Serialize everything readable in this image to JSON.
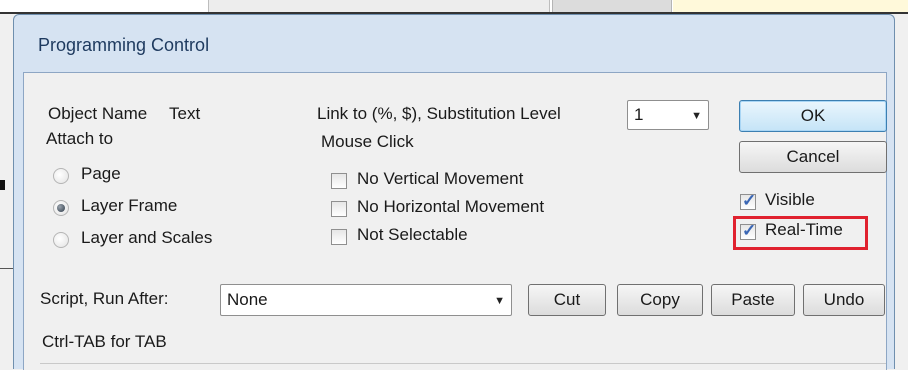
{
  "dialog": {
    "title": "Programming Control",
    "object_name_label": "Object Name",
    "object_name_value": "Text",
    "attach_to_label": "Attach to",
    "attach_options": [
      {
        "label": "Page",
        "selected": false
      },
      {
        "label": "Layer Frame",
        "selected": true
      },
      {
        "label": "Layer and Scales",
        "selected": false
      }
    ],
    "link_label": "Link to (%, $), Substitution Level",
    "substitution_level": "1",
    "mouse_click_label": "Mouse Click",
    "mouse_options": [
      {
        "label": "No Vertical Movement",
        "checked": false
      },
      {
        "label": "No Horizontal Movement",
        "checked": false
      },
      {
        "label": "Not Selectable",
        "checked": false
      }
    ],
    "ok_label": "OK",
    "cancel_label": "Cancel",
    "visible_label": "Visible",
    "visible_checked": true,
    "realtime_label": "Real-Time",
    "realtime_checked": true,
    "script_label": "Script, Run After:",
    "script_value": "None",
    "cut_label": "Cut",
    "copy_label": "Copy",
    "paste_label": "Paste",
    "undo_label": "Undo",
    "hint": "Ctrl-TAB for TAB",
    "check_glyph": "✓",
    "dropdown_glyph": "▼"
  },
  "colors": {
    "frame": "#d6e3f2",
    "highlight": "#e0212e",
    "check": "#3a66b4"
  }
}
